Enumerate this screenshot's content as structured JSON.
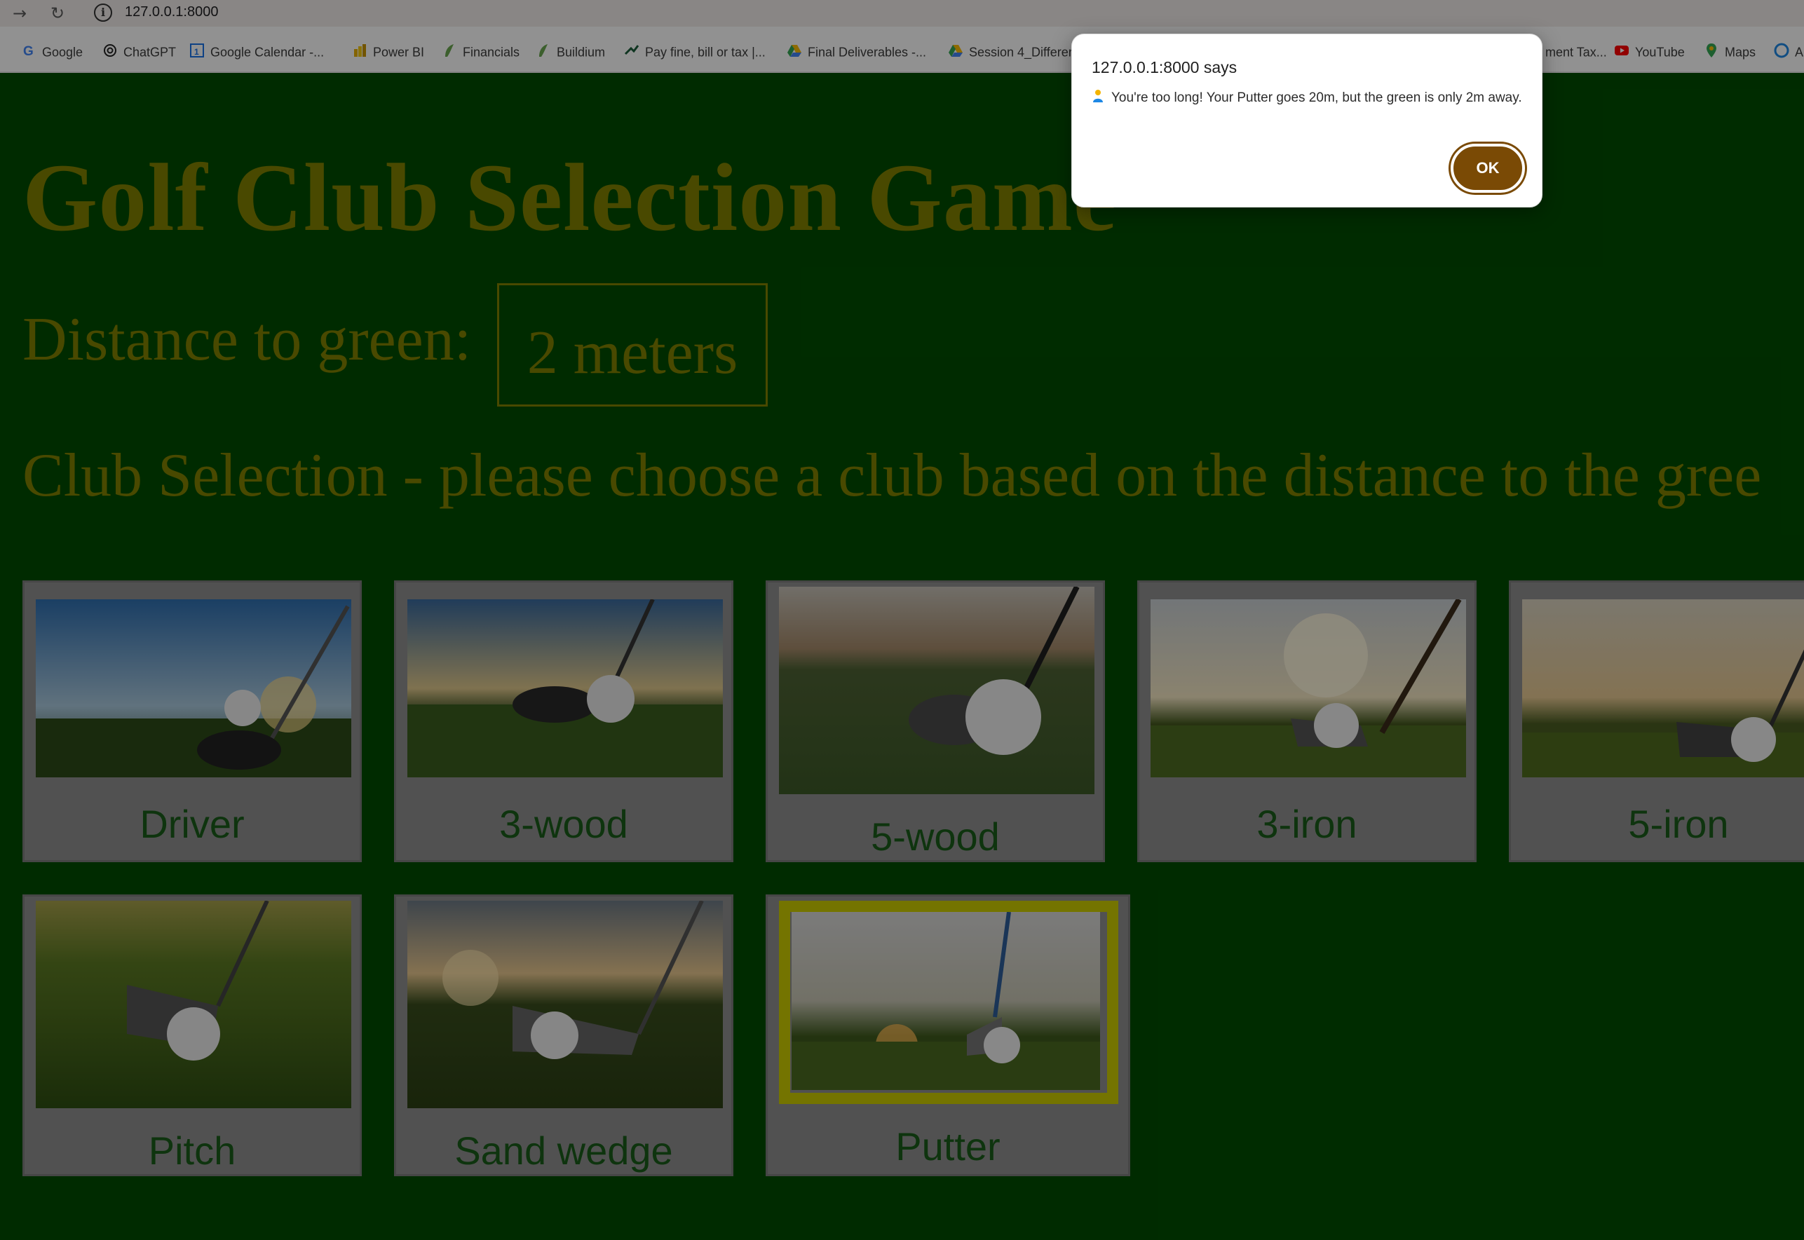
{
  "browser": {
    "url": "127.0.0.1:8000",
    "bookmarks": [
      {
        "label": "Google",
        "icon": "google-icon"
      },
      {
        "label": "ChatGPT",
        "icon": "chatgpt-icon"
      },
      {
        "label": "Google Calendar -...",
        "icon": "calendar-icon"
      },
      {
        "label": "Power BI",
        "icon": "powerbi-icon"
      },
      {
        "label": "Financials",
        "icon": "leaf-icon"
      },
      {
        "label": "Buildium",
        "icon": "leaf-icon"
      },
      {
        "label": "Pay fine, bill or tax |...",
        "icon": "pay-icon"
      },
      {
        "label": "Final Deliverables -...",
        "icon": "drive-icon"
      },
      {
        "label": "Session 4_Differer",
        "icon": "drive-icon"
      },
      {
        "label": "ment Tax...",
        "icon": ""
      },
      {
        "label": "YouTube",
        "icon": "youtube-icon"
      },
      {
        "label": "Maps",
        "icon": "maps-icon"
      },
      {
        "label": "A",
        "icon": "edge-icon"
      }
    ]
  },
  "game": {
    "title": "Golf Club Selection Game",
    "distance_label": "Distance to green:",
    "distance_value": "2 meters",
    "subtitle": "Club Selection - please choose a club based on the distance to the gree",
    "clubs": [
      {
        "name": "Driver",
        "selected": false
      },
      {
        "name": "3-wood",
        "selected": false
      },
      {
        "name": "5-wood",
        "selected": false
      },
      {
        "name": "3-iron",
        "selected": false
      },
      {
        "name": "5-iron",
        "selected": false
      },
      {
        "name": "Pitch",
        "selected": false
      },
      {
        "name": "Sand wedge",
        "selected": false
      },
      {
        "name": "Putter",
        "selected": true
      }
    ]
  },
  "dialog": {
    "title": "127.0.0.1:8000 says",
    "message": "You're too long! Your Putter goes 20m, but the green is only 2m away.",
    "ok_label": "OK"
  },
  "colors": {
    "page_bg": "#004d00",
    "heading": "#808000",
    "card_bg": "#8f8f8f",
    "selected_border": "#cccc00",
    "ok_button": "#7a4a05"
  }
}
